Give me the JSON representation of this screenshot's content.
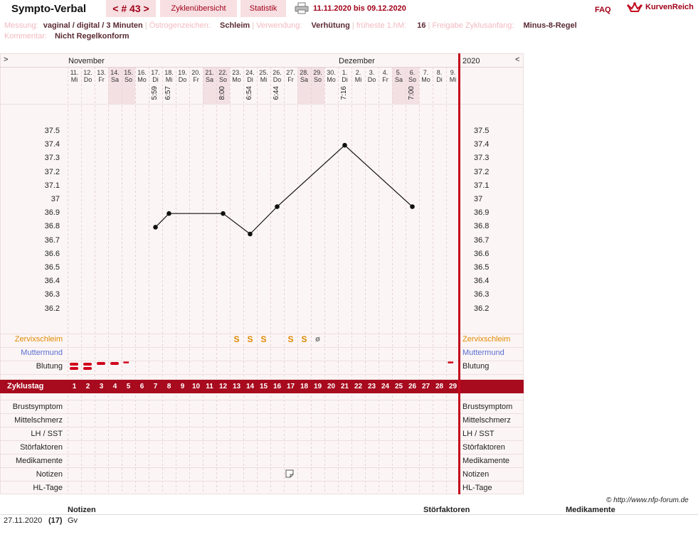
{
  "header": {
    "app_title": "Sympto-Verbal",
    "cycle": "< # 43 >",
    "tab_overview": "Zyklenübersicht",
    "tab_stats": "Statistik",
    "date_range": "11.11.2020 bis 09.12.2020",
    "faq": "FAQ",
    "brand": "KurvenReich"
  },
  "meta": {
    "messung_label": "Messung:",
    "messung_value": "vaginal / digital / 3 Minuten",
    "oestrogen_label": "Östrogenzeichen:",
    "oestrogen_value": "Schleim",
    "verwendung_label": "Verwendung:",
    "verwendung_value": "Verhütung",
    "fruehest_label": "früheste 1.hM:",
    "fruehest_value": "16",
    "freigabe_label": "Freigabe Zyklusanfang:",
    "freigabe_value": "Minus-8-Regel",
    "kommentar_label": "Kommentar:",
    "kommentar_value": "Nicht Regelkonform"
  },
  "months": {
    "left_arrow": ">",
    "right_arrow": "<",
    "m1": "November",
    "m2": "Dezember",
    "year": "2020"
  },
  "days": [
    {
      "d": "11.",
      "w": "Mi"
    },
    {
      "d": "12.",
      "w": "Do"
    },
    {
      "d": "13.",
      "w": "Fr"
    },
    {
      "d": "14.",
      "w": "Sa"
    },
    {
      "d": "15.",
      "w": "So"
    },
    {
      "d": "16.",
      "w": "Mo"
    },
    {
      "d": "17.",
      "w": "Di"
    },
    {
      "d": "18.",
      "w": "Mi"
    },
    {
      "d": "19.",
      "w": "Do"
    },
    {
      "d": "20.",
      "w": "Fr"
    },
    {
      "d": "21.",
      "w": "Sa"
    },
    {
      "d": "22.",
      "w": "So"
    },
    {
      "d": "23.",
      "w": "Mo"
    },
    {
      "d": "24.",
      "w": "Di"
    },
    {
      "d": "25.",
      "w": "Mi"
    },
    {
      "d": "26.",
      "w": "Do"
    },
    {
      "d": "27.",
      "w": "Fr"
    },
    {
      "d": "28.",
      "w": "Sa"
    },
    {
      "d": "29.",
      "w": "So"
    },
    {
      "d": "30.",
      "w": "Mo"
    },
    {
      "d": "1.",
      "w": "Di"
    },
    {
      "d": "2.",
      "w": "Mi"
    },
    {
      "d": "3.",
      "w": "Do"
    },
    {
      "d": "4.",
      "w": "Fr"
    },
    {
      "d": "5.",
      "w": "Sa"
    },
    {
      "d": "6.",
      "w": "So"
    },
    {
      "d": "7.",
      "w": "Mo"
    },
    {
      "d": "8.",
      "w": "Di"
    },
    {
      "d": "9.",
      "w": "Mi"
    }
  ],
  "times": [
    {
      "day": 7,
      "t": "5:59"
    },
    {
      "day": 8,
      "t": "6:57"
    },
    {
      "day": 12,
      "t": "8:00"
    },
    {
      "day": 14,
      "t": "6:54"
    },
    {
      "day": 16,
      "t": "6:44"
    },
    {
      "day": 21,
      "t": "7:16"
    },
    {
      "day": 26,
      "t": "7:00"
    }
  ],
  "rows": {
    "zervix": "Zervixschleim",
    "muttermund": "Muttermund",
    "blutung": "Blutung",
    "zyklustag": "Zyklustag",
    "brust": "Brustsymptom",
    "mittel": "Mittelschmerz",
    "lh": "LH / SST",
    "stoer": "Störfaktoren",
    "medi": "Medikamente",
    "notizen": "Notizen",
    "hl": "HL-Tage"
  },
  "cervix_marks": [
    {
      "day": 13,
      "sym": "S"
    },
    {
      "day": 14,
      "sym": "S"
    },
    {
      "day": 15,
      "sym": "S"
    },
    {
      "day": 17,
      "sym": "S"
    },
    {
      "day": 18,
      "sym": "S"
    },
    {
      "day": 19,
      "sym": "ø"
    }
  ],
  "footer": {
    "copyright": "© http://www.nfp-forum.de",
    "col_notizen": "Notizen",
    "col_stoer": "Störfaktoren",
    "col_medi": "Medikamente",
    "note_date": "27.11.2020",
    "note_day": "(17)",
    "note_text": "Gv"
  },
  "chart_data": {
    "type": "line",
    "ylim": [
      36.2,
      37.5
    ],
    "yticks": [
      "37.5",
      "37.4",
      "37.3",
      "37.2",
      "37.1",
      "37",
      "36.9",
      "36.8",
      "36.7",
      "36.6",
      "36.5",
      "36.4",
      "36.3",
      "36.2"
    ],
    "x_cycle_days": [
      1,
      2,
      3,
      4,
      5,
      6,
      7,
      8,
      9,
      10,
      11,
      12,
      13,
      14,
      15,
      16,
      17,
      18,
      19,
      20,
      21,
      22,
      23,
      24,
      25,
      26,
      27,
      28,
      29
    ],
    "points": [
      {
        "x": 7,
        "y": 36.8
      },
      {
        "x": 8,
        "y": 36.9
      },
      {
        "x": 12,
        "y": 36.9
      },
      {
        "x": 14,
        "y": 36.75
      },
      {
        "x": 16,
        "y": 36.95
      },
      {
        "x": 21,
        "y": 37.4
      },
      {
        "x": 26,
        "y": 36.95
      }
    ]
  }
}
